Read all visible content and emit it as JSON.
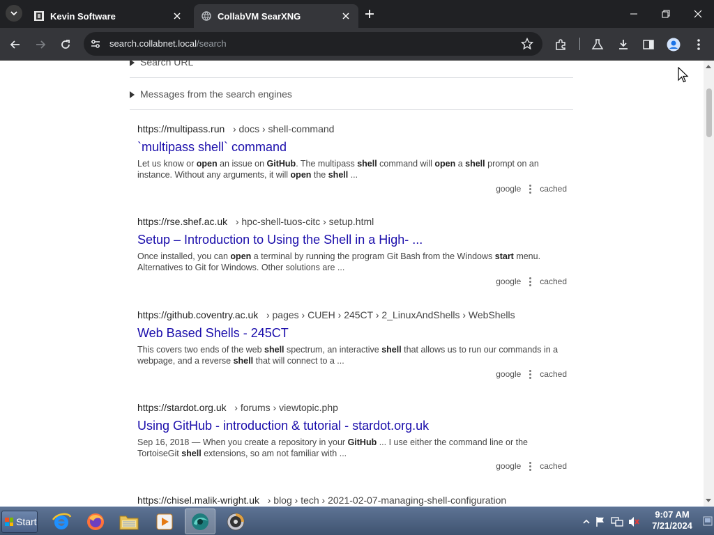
{
  "browser": {
    "tabs": [
      {
        "label": "Kevin Software",
        "active": false
      },
      {
        "label": "CollabVM SearXNG",
        "active": true
      }
    ],
    "url": {
      "host": "search.collabnet.local",
      "path": "/search"
    }
  },
  "details": [
    {
      "label": "Search URL"
    },
    {
      "label": "Messages from the search engines"
    }
  ],
  "results": [
    {
      "url": "https://multipass.run",
      "crumbs": "› docs › shell-command",
      "title": "`multipass shell` command",
      "snippet_html": "Let us know or <b>open</b> an issue on <b>GitHub</b>. The multipass <b>shell</b> command will <b>open</b> a <b>shell</b> prompt on an instance. Without any arguments, it will <b>open</b> the <b>shell</b> ...",
      "engine": "google",
      "cached": "cached"
    },
    {
      "url": "https://rse.shef.ac.uk",
      "crumbs": "› hpc-shell-tuos-citc › setup.html",
      "title": "Setup – Introduction to Using the Shell in a High- ...",
      "snippet_html": "Once installed, you can <b>open</b> a terminal by running the program Git Bash from the Windows <b>start</b> menu. Alternatives to Git for Windows. Other solutions are ...",
      "engine": "google",
      "cached": "cached"
    },
    {
      "url": "https://github.coventry.ac.uk",
      "crumbs": "› pages › CUEH › 245CT › 2_LinuxAndShells › WebShells",
      "title": "Web Based Shells - 245CT",
      "snippet_html": "This covers two ends of the web <b>shell</b> spectrum, an interactive <b>shell</b> that allows us to run our commands in a webpage, and a reverse <b>shell</b> that will connect to a ...",
      "engine": "google",
      "cached": "cached"
    },
    {
      "url": "https://stardot.org.uk",
      "crumbs": "› forums › viewtopic.php",
      "title": "Using GitHub - introduction & tutorial - stardot.org.uk",
      "snippet_html": "Sep 16, 2018 — When you create a repository in your <b>GitHub</b> ... I use either the command line or the TortoiseGit <b>shell</b> extensions, so am not familiar with ...",
      "engine": "google",
      "cached": "cached"
    },
    {
      "url": "https://chisel.malik-wright.uk",
      "crumbs": "› blog › tech › 2021-02-07-managing-shell-configuration",
      "title": "",
      "snippet_html": "",
      "engine": "",
      "cached": ""
    }
  ],
  "taskbar": {
    "start_label": "Start",
    "time": "9:07 AM",
    "date": "7/21/2024"
  },
  "colors": {
    "link": "#1a0dab",
    "tab_bg": "#202124",
    "toolbar_bg": "#35363a"
  }
}
